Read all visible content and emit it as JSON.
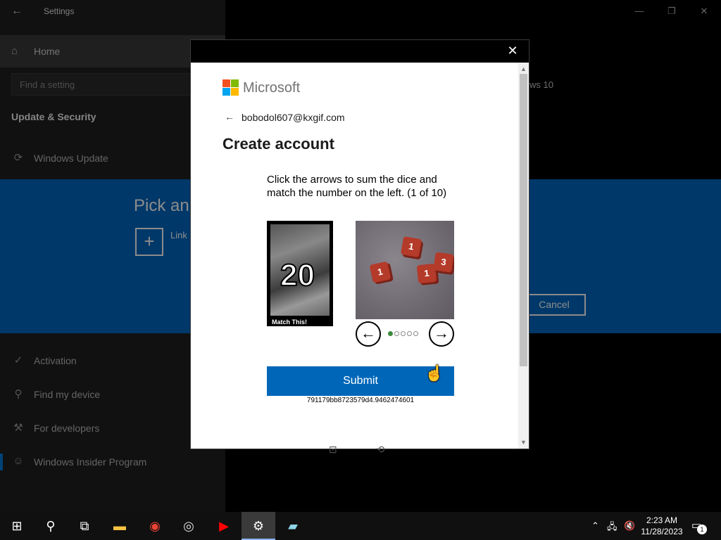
{
  "settings": {
    "window_title": "Settings",
    "home_label": "Home",
    "search_placeholder": "Find a setting",
    "section_title": "Update & Security",
    "nav_items": [
      {
        "label": "Windows Update",
        "icon": "refresh-icon"
      },
      {
        "label": "Activation",
        "icon": "check-circle-icon"
      },
      {
        "label": "Find my device",
        "icon": "person-pin-icon"
      },
      {
        "label": "For developers",
        "icon": "developer-tools-icon"
      },
      {
        "label": "Windows Insider Program",
        "icon": "insider-cat-icon"
      }
    ],
    "background_heading": "Pick an",
    "link_text": "Link",
    "cancel_label": "Cancel",
    "windows_version_fragment": "ws 10"
  },
  "dialog": {
    "brand": "Microsoft",
    "email": "bobodol607@kxgif.com",
    "heading": "Create account",
    "instructions": "Click the arrows to sum the dice and match the number on the left. (1 of 10)",
    "target_number": "20",
    "target_label": "Match This!",
    "dice_values": [
      "1",
      "1",
      "1",
      "3"
    ],
    "carousel_total": 5,
    "carousel_active": 1,
    "submit_label": "Submit",
    "token": "791179bb8723579d4.9462474601"
  },
  "taskbar": {
    "time": "2:23 AM",
    "date": "11/28/2023",
    "notification_count": "1",
    "apps": [
      "start-icon",
      "search-icon",
      "task-view-icon",
      "file-explorer-icon",
      "chrome-icon",
      "obs-icon",
      "youtube-icon",
      "settings-icon",
      "notepad-icon"
    ]
  },
  "colors": {
    "accent_blue": "#0067c0",
    "submit_blue": "#0067b8",
    "dice_red": "#b43a2a"
  }
}
